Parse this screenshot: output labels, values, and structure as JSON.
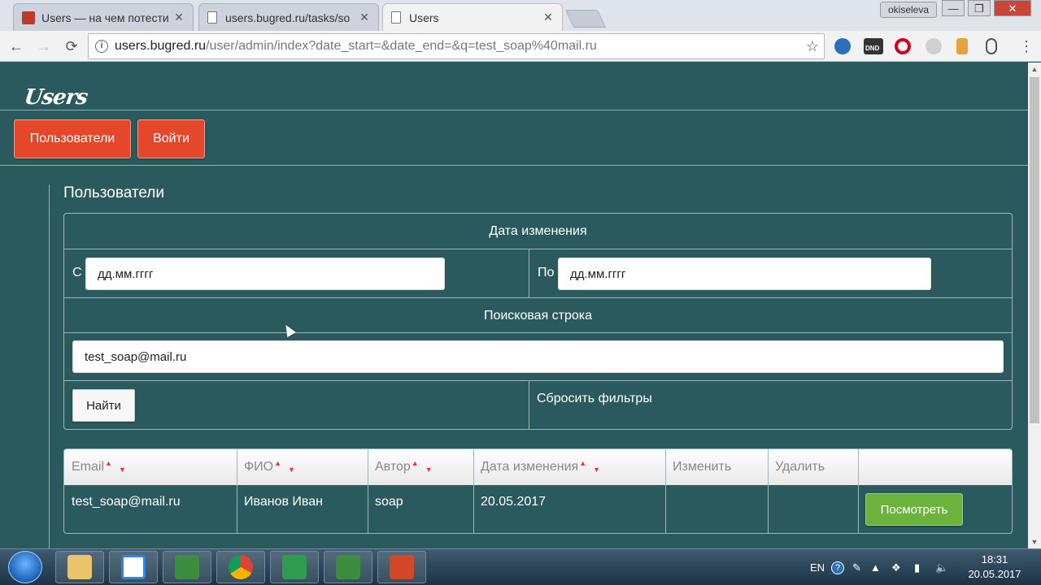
{
  "browser": {
    "tabs": [
      {
        "title": "Users — на чем потести",
        "close": "✕",
        "active": false
      },
      {
        "title": "users.bugred.ru/tasks/so",
        "close": "✕",
        "active": false
      },
      {
        "title": "Users",
        "close": "✕",
        "active": true
      }
    ],
    "profile": "okiseleva",
    "window_controls": {
      "minimize": "—",
      "maximize": "❐",
      "close": "✕"
    },
    "url_host": "users.bugred.ru",
    "url_path": "/user/admin/index?date_start=&date_end=&q=test_soap%40mail.ru",
    "info_glyph": "i",
    "extensions": [
      {
        "name": "globe-icon",
        "color": "#2a6fb8"
      },
      {
        "name": "dnd-icon",
        "color": "#333333",
        "label": "DND"
      },
      {
        "name": "opera-icon",
        "color": "#d0021b"
      },
      {
        "name": "shield-icon",
        "color": "#b0b0b0"
      },
      {
        "name": "pin-icon",
        "color": "#e6a23c"
      },
      {
        "name": "clip-icon",
        "color": "#555555"
      }
    ]
  },
  "site": {
    "logo": "Users",
    "nav": {
      "users": "Пользователи",
      "login": "Войти"
    },
    "section_title": "Пользователи"
  },
  "filter": {
    "date_header": "Дата изменения",
    "from_label": "С",
    "from_placeholder": "дд.мм.гггг",
    "to_label": "По",
    "to_placeholder": "дд.мм.гггг",
    "search_header": "Поисковая строка",
    "search_value": "test_soap@mail.ru",
    "find_button": "Найти",
    "reset_link": "Сбросить фильтры"
  },
  "table": {
    "columns": [
      "Email",
      "ФИО",
      "Автор",
      "Дата изменения",
      "Изменить",
      "Удалить"
    ],
    "sortable": [
      true,
      true,
      true,
      true,
      false,
      false
    ],
    "sort_up": "▲",
    "sort_down": "▼",
    "rows": [
      {
        "email": "test_soap@mail.ru",
        "fio": "Иванов Иван",
        "author": "soap",
        "date": "20.05.2017",
        "view_button": "Посмотреть"
      }
    ]
  },
  "taskbar": {
    "apps": [
      {
        "name": "explorer-icon",
        "color": "#e9c46a"
      },
      {
        "name": "dropbox-icon",
        "color": "#2e86de"
      },
      {
        "name": "camtasia-icon",
        "color": "#3c8d40"
      },
      {
        "name": "chrome-icon",
        "color": "#db4437"
      },
      {
        "name": "snagit-icon",
        "color": "#2e9b4e"
      },
      {
        "name": "camtasia-recorder-icon",
        "color": "#3c8d40"
      },
      {
        "name": "powerpoint-icon",
        "color": "#d24726"
      }
    ],
    "language": "EN",
    "time": "18:31",
    "date": "20.05.2017"
  }
}
